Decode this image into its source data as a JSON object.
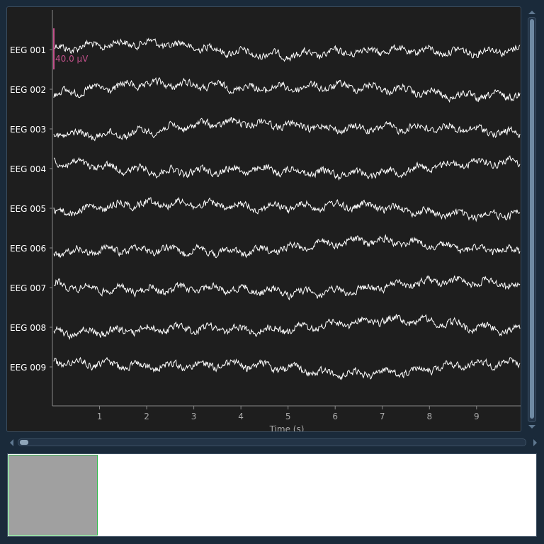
{
  "window": {
    "background": "#1a2a3a"
  },
  "plot": {
    "background": "#1e1e1e",
    "trace_color": "#ffffff",
    "scale_bar_color": "#c2508a",
    "scale_bar_label": "40.0 µV",
    "x_axis_label": "Time (s)"
  },
  "chart_data": {
    "type": "line",
    "xlabel": "Time (s)",
    "xlim": [
      0,
      9.95
    ],
    "x_ticks": [
      1,
      2,
      3,
      4,
      5,
      6,
      7,
      8,
      9
    ],
    "channels": [
      "EEG 001",
      "EEG 002",
      "EEG 003",
      "EEG 004",
      "EEG 005",
      "EEG 006",
      "EEG 007",
      "EEG 008",
      "EEG 009"
    ]
  },
  "overview": {
    "background": "#ffffff",
    "window_color": "#a0a0a0",
    "window_border": "#2fb84a"
  }
}
